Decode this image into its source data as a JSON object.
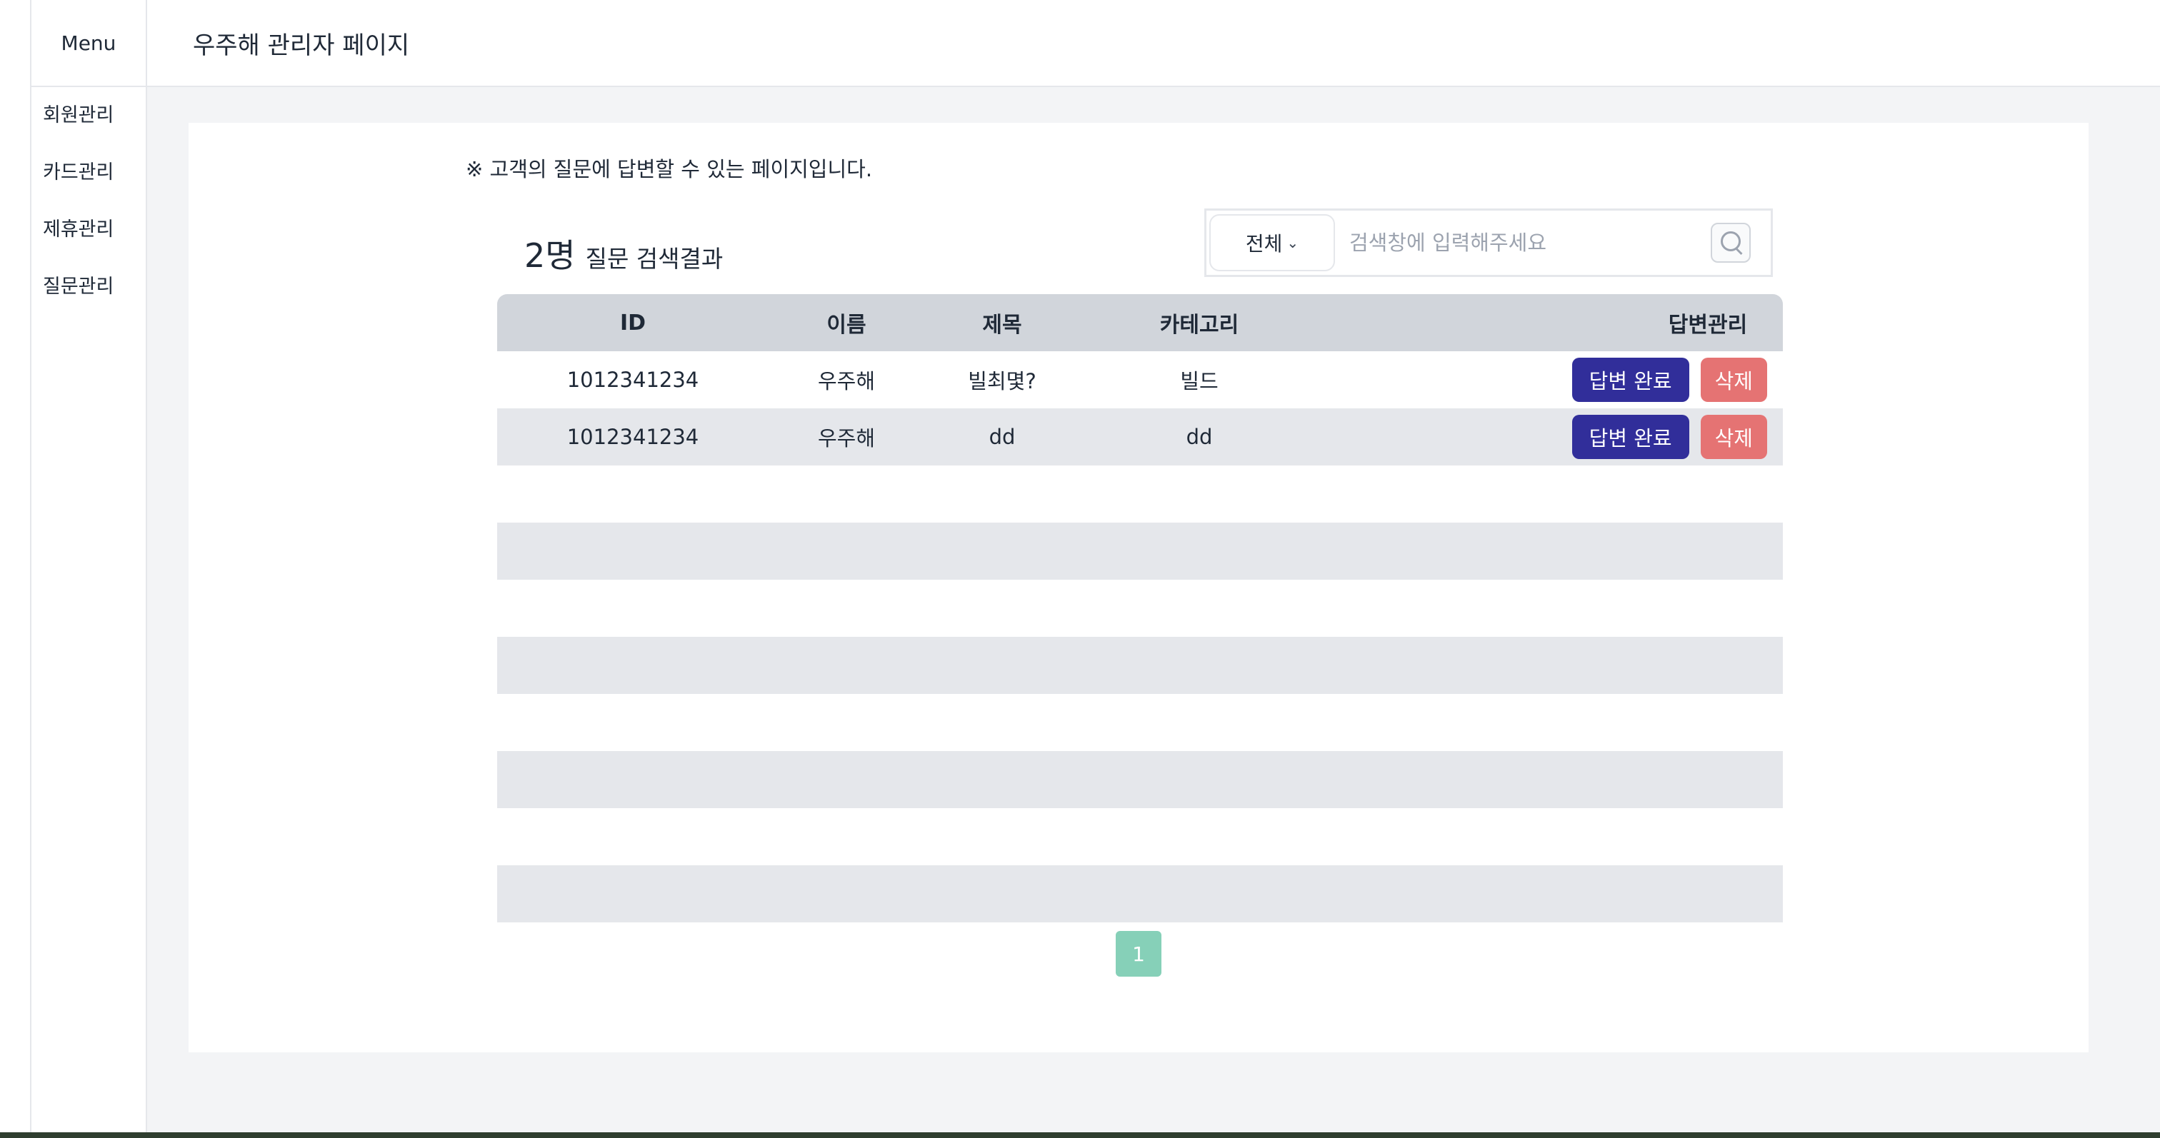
{
  "sidebar": {
    "menu_label": "Menu",
    "items": [
      {
        "label": "회원관리"
      },
      {
        "label": "카드관리"
      },
      {
        "label": "제휴관리"
      },
      {
        "label": "질문관리"
      }
    ]
  },
  "header": {
    "title": "우주해 관리자 페이지"
  },
  "main": {
    "notice": "※ 고객의 질문에 답변할 수 있는 페이지입니다.",
    "result_count": "2명",
    "result_label": "질문 검색결과",
    "search": {
      "category_value": "전체",
      "placeholder": "검색창에 입력해주세요",
      "icon": "search-icon"
    },
    "table": {
      "headers": {
        "id": "ID",
        "name": "이름",
        "title": "제목",
        "category": "카테고리",
        "manage": "답변관리"
      },
      "rows": [
        {
          "id": "1012341234",
          "name": "우주해",
          "title": "빌최몇?",
          "category": "빌드",
          "done_label": "답변 완료",
          "delete_label": "삭제"
        },
        {
          "id": "1012341234",
          "name": "우주해",
          "title": "dd",
          "category": "dd",
          "done_label": "답변 완료",
          "delete_label": "삭제"
        }
      ]
    },
    "pagination": {
      "current_page": "1"
    }
  },
  "colors": {
    "done_button": "#312e9a",
    "delete_button": "#e57373",
    "page_button": "#86d0b8",
    "header_row": "#d1d5db",
    "striped_row": "#e5e7eb"
  }
}
